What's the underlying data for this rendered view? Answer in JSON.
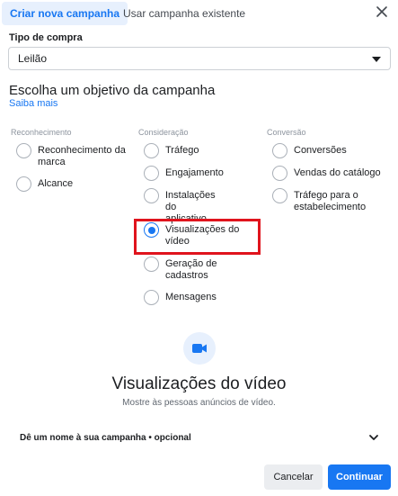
{
  "tabs": [
    {
      "label": "Criar nova campanha",
      "active": true
    },
    {
      "label": "Usar campanha existente",
      "active": false
    }
  ],
  "purchase_type": {
    "label": "Tipo de compra",
    "value": "Leilão"
  },
  "objective": {
    "heading": "Escolha um objetivo da campanha",
    "learn_more": "Saiba mais"
  },
  "columns": [
    {
      "title": "Reconhecimento",
      "options": [
        {
          "label": "Reconhecimento da marca",
          "selected": false
        },
        {
          "label": "Alcance",
          "selected": false
        }
      ]
    },
    {
      "title": "Consideração",
      "options": [
        {
          "label": "Tráfego",
          "selected": false
        },
        {
          "label": "Engajamento",
          "selected": false
        },
        {
          "label": "Instalações do aplicativo",
          "selected": false
        },
        {
          "label": "Visualizações do vídeo",
          "selected": true
        },
        {
          "label": "Geração de cadastros",
          "selected": false
        },
        {
          "label": "Mensagens",
          "selected": false
        }
      ]
    },
    {
      "title": "Conversão",
      "options": [
        {
          "label": "Conversões",
          "selected": false
        },
        {
          "label": "Vendas do catálogo",
          "selected": false
        },
        {
          "label": "Tráfego para o estabelecimento",
          "selected": false
        }
      ]
    }
  ],
  "selected_detail": {
    "icon": "video-camera-icon",
    "title": "Visualizações do vídeo",
    "description": "Mostre às pessoas anúncios de vídeo."
  },
  "name_section": {
    "label": "Dê um nome à sua campanha • opcional"
  },
  "buttons": {
    "cancel": "Cancelar",
    "continue": "Continuar"
  },
  "colors": {
    "accent": "#1877f2",
    "highlight": "#e0141d",
    "tab_active_bg": "#e7f0fd"
  }
}
